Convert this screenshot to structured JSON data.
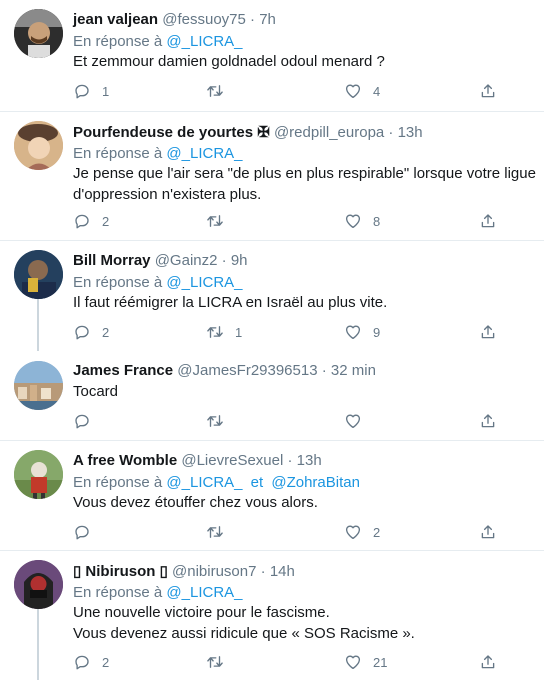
{
  "reply_prefix": "En réponse à",
  "and_word": "et",
  "tweets": [
    {
      "name": "jean valjean",
      "handle": "@fessuoy75",
      "time": "7h",
      "reply_to": [
        "@_LICRA_"
      ],
      "lines": [
        "Et zemmour damien goldnadel odoul menard ?"
      ],
      "replies": "1",
      "retweets": "",
      "likes": "4"
    },
    {
      "name": "Pourfendeuse de yourtes ✠",
      "handle": "@redpill_europa",
      "time": "13h",
      "reply_to": [
        "@_LICRA_"
      ],
      "lines": [
        "Je pense que l'air sera \"de plus en plus respirable\" lorsque votre ligue",
        "d'oppression n'existera plus."
      ],
      "replies": "2",
      "retweets": "",
      "likes": "8"
    },
    {
      "name": "Bill Morray",
      "handle": "@Gainz2",
      "time": "9h",
      "reply_to": [
        "@_LICRA_"
      ],
      "lines": [
        "Il faut réémigrer la LICRA en Israël au plus vite."
      ],
      "replies": "2",
      "retweets": "1",
      "likes": "9"
    },
    {
      "name": "James France",
      "handle": "@JamesFr29396513",
      "time": "32 min",
      "reply_to": [],
      "lines": [
        "Tocard"
      ],
      "replies": "",
      "retweets": "",
      "likes": ""
    },
    {
      "name": "A free Womble",
      "handle": "@LievreSexuel",
      "time": "13h",
      "reply_to": [
        "@_LICRA_",
        "@ZohraBitan"
      ],
      "lines": [
        "Vous devez étouffer chez vous alors."
      ],
      "replies": "",
      "retweets": "",
      "likes": "2"
    },
    {
      "name": "▯ Nibiruson ▯",
      "handle": "@nibiruson7",
      "time": "14h",
      "reply_to": [
        "@_LICRA_"
      ],
      "lines": [
        "Une nouvelle victoire pour le fascisme.",
        "Vous devenez aussi ridicule que « SOS Racisme »."
      ],
      "replies": "2",
      "retweets": "",
      "likes": "21"
    }
  ]
}
